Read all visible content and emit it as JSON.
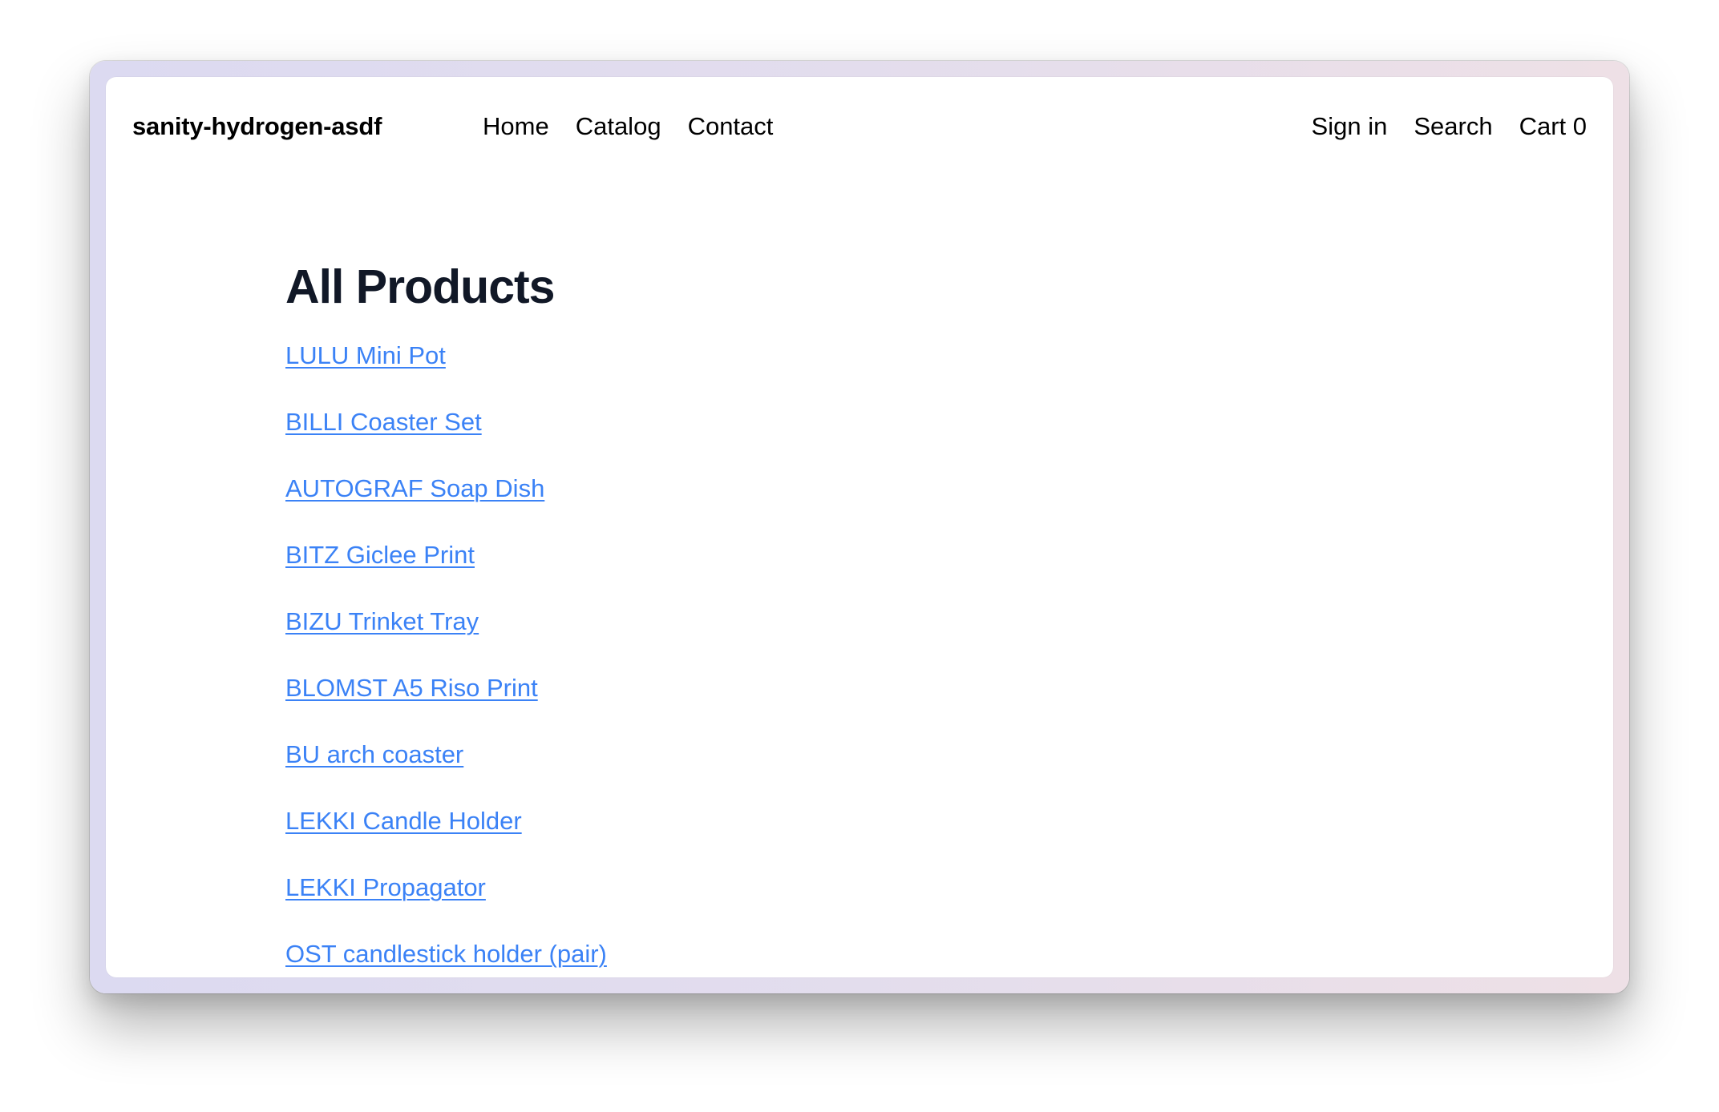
{
  "header": {
    "logo": "sanity-hydrogen-asdf",
    "nav": [
      {
        "label": "Home"
      },
      {
        "label": "Catalog"
      },
      {
        "label": "Contact"
      }
    ],
    "actions": {
      "sign_in": "Sign in",
      "search": "Search",
      "cart": "Cart 0"
    }
  },
  "main": {
    "title": "All Products",
    "products": [
      {
        "label": "LULU Mini Pot"
      },
      {
        "label": "BILLI Coaster Set"
      },
      {
        "label": "AUTOGRAF Soap Dish"
      },
      {
        "label": "BITZ Giclee Print"
      },
      {
        "label": "BIZU Trinket Tray"
      },
      {
        "label": "BLOMST A5 Riso Print"
      },
      {
        "label": "BU arch coaster"
      },
      {
        "label": "LEKKI Candle Holder"
      },
      {
        "label": "LEKKI Propagator"
      },
      {
        "label": "OST candlestick holder (pair)"
      }
    ]
  },
  "colors": {
    "link": "#3b82f6",
    "heading": "#111827",
    "text": "#000000",
    "frame_left": "#dcdaf1",
    "frame_right": "#eee0e6"
  }
}
